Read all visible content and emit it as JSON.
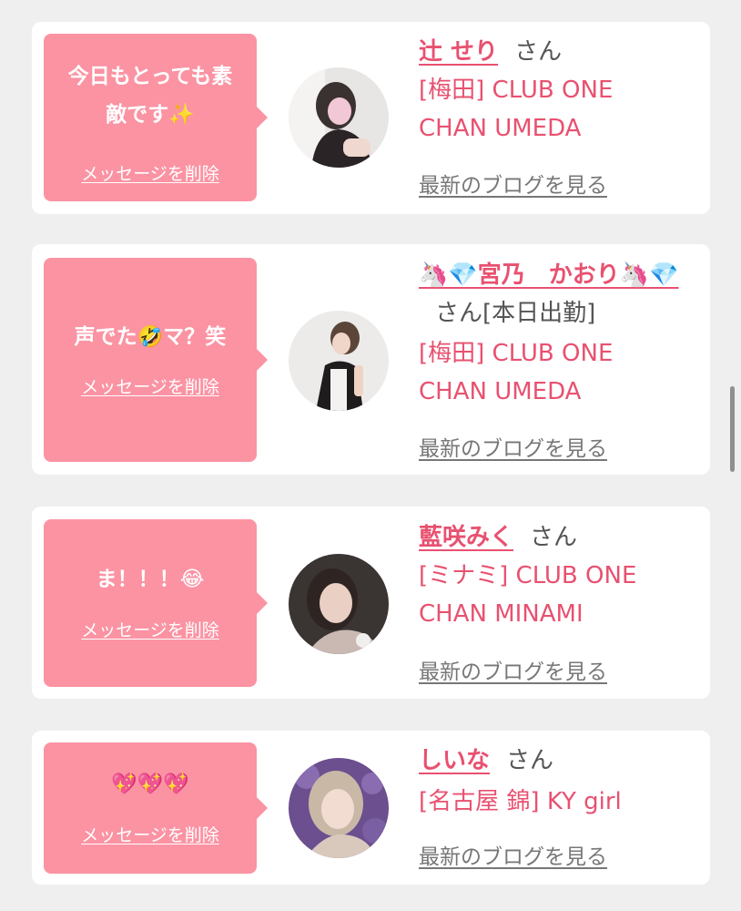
{
  "delete_label": "メッセージを削除",
  "blog_label": "最新のブログを見る",
  "cards": [
    {
      "message": "今日もとっても素\n敵です✨",
      "name": "辻 せり",
      "suffix": "さん",
      "shop_line1": "[梅田] CLUB ONE",
      "shop_line2": "CHAN UMEDA"
    },
    {
      "message": "声でた🤣マ？笑",
      "name": "🦄💎宮乃　かおり🦄💎",
      "suffix": "さん[本日出勤]",
      "shop_line1": "[梅田] CLUB ONE",
      "shop_line2": "CHAN UMEDA"
    },
    {
      "message": "ま！！！😂",
      "name": "藍咲みく",
      "suffix": "さん",
      "shop_line1": "[ミナミ] CLUB ONE",
      "shop_line2": "CHAN MINAMI"
    },
    {
      "message": "💖💖💖",
      "name": "しいな",
      "suffix": "さん",
      "shop_line1": "[名古屋 錦] KY girl",
      "shop_line2": ""
    }
  ],
  "colors": {
    "bubble": "#fb93a3",
    "accent": "#e85170",
    "page_bg": "#efefef"
  }
}
